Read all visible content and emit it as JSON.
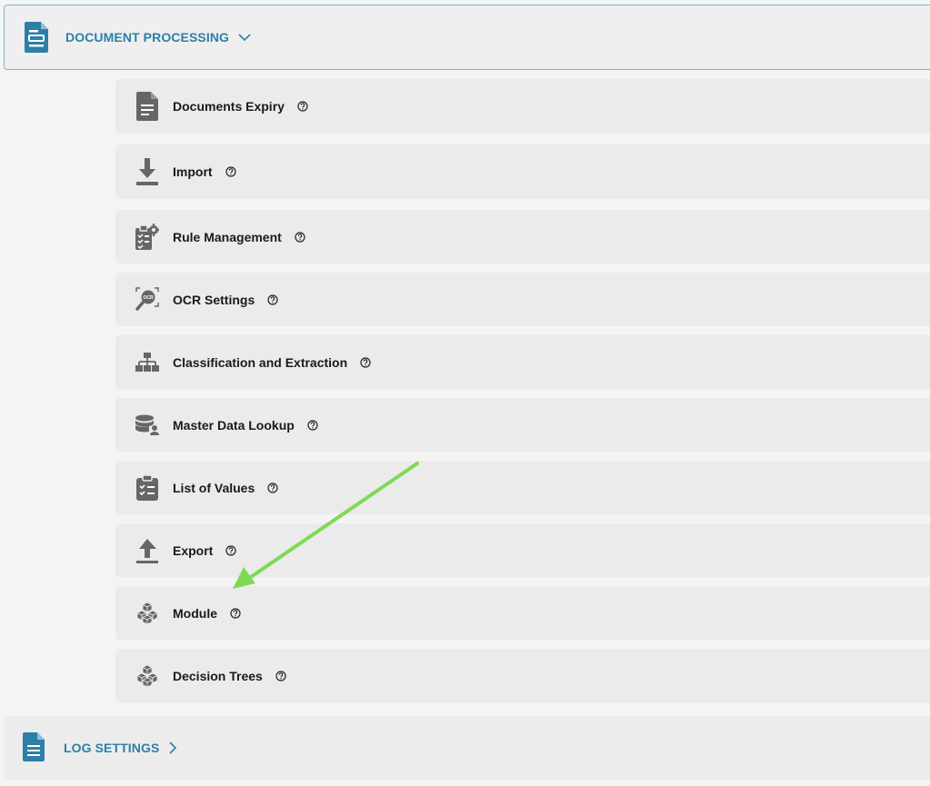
{
  "sections": {
    "document_processing": {
      "title": "DOCUMENT PROCESSING",
      "expanded": true,
      "icon": "document-processing-icon"
    },
    "log_settings": {
      "title": "LOG SETTINGS",
      "expanded": false,
      "icon": "log-document-icon"
    }
  },
  "items": [
    {
      "label": "Documents Expiry",
      "icon": "document-icon"
    },
    {
      "label": "Import",
      "icon": "download-icon"
    },
    {
      "label": "Rule Management",
      "icon": "clipboard-gear-icon"
    },
    {
      "label": "OCR Settings",
      "icon": "ocr-search-icon"
    },
    {
      "label": "Classification and Extraction",
      "icon": "hierarchy-icon"
    },
    {
      "label": "Master Data Lookup",
      "icon": "database-user-icon"
    },
    {
      "label": "List of Values",
      "icon": "checklist-icon"
    },
    {
      "label": "Export",
      "icon": "upload-icon"
    },
    {
      "label": "Module",
      "icon": "cubes-icon"
    },
    {
      "label": "Decision Trees",
      "icon": "cubes-icon"
    }
  ],
  "colors": {
    "accent": "#2e7fa7",
    "icon_gray": "#666666",
    "annotation_arrow": "#7ed957"
  }
}
